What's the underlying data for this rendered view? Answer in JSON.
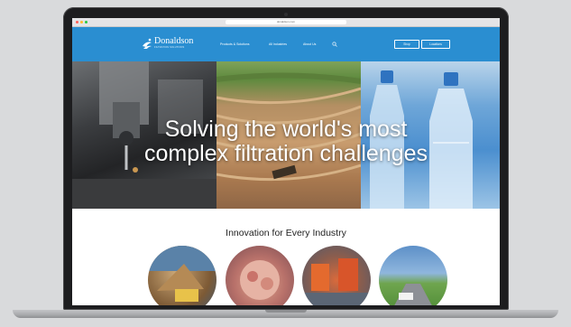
{
  "browser": {
    "url": "donaldson.com"
  },
  "header": {
    "logo": {
      "name": "Donaldson",
      "tagline": "FILTRATION SOLUTIONS"
    },
    "nav": [
      {
        "label": "Products & Solutions"
      },
      {
        "label": "All Industries"
      },
      {
        "label": "About Us"
      }
    ],
    "buttons": [
      {
        "label": "Shop"
      },
      {
        "label": "Locations"
      }
    ],
    "icons": {
      "search": "search-icon",
      "logo_mark": "donaldson-logo-mark"
    },
    "colors": {
      "header_bg": "#2a8ed1"
    }
  },
  "hero": {
    "title_line_1": "Solving the world's most",
    "title_line_2": "complex filtration challenges"
  },
  "industries": {
    "title": "Innovation for Every Industry"
  }
}
